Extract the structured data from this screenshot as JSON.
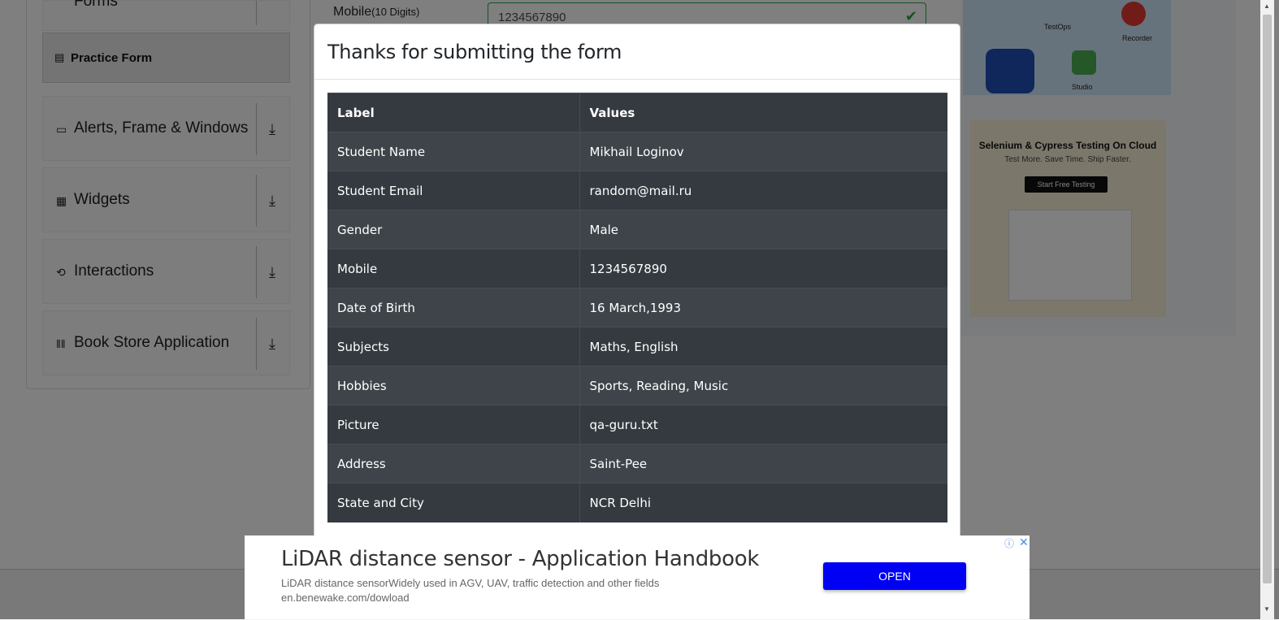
{
  "sidebar": {
    "forms_label": "Forms",
    "practice_form": "Practice Form",
    "groups": [
      {
        "label": "Alerts, Frame & Windows",
        "icon": "window-icon"
      },
      {
        "label": "Widgets",
        "icon": "widgets-icon"
      },
      {
        "label": "Interactions",
        "icon": "interactions-icon"
      },
      {
        "label": "Book Store Application",
        "icon": "books-icon"
      }
    ]
  },
  "form": {
    "mobile_label": "Mobile",
    "mobile_hint": "(10 Digits)",
    "mobile_value": "1234567890"
  },
  "right_ads": {
    "ad1": {
      "labels": [
        "TestOps",
        "Recorder",
        "Studio"
      ]
    },
    "ad2": {
      "title": "Selenium & Cypress Testing On Cloud",
      "subtitle": "Test More. Save Time. Ship Faster.",
      "button": "Start Free Testing"
    }
  },
  "modal": {
    "title": "Thanks for submitting the form",
    "columns": [
      "Label",
      "Values"
    ],
    "rows": [
      [
        "Student Name",
        "Mikhail Loginov"
      ],
      [
        "Student Email",
        "random@mail.ru"
      ],
      [
        "Gender",
        "Male"
      ],
      [
        "Mobile",
        "1234567890"
      ],
      [
        "Date of Birth",
        "16 March,1993"
      ],
      [
        "Subjects",
        "Maths, English"
      ],
      [
        "Hobbies",
        "Sports, Reading, Music"
      ],
      [
        "Picture",
        "qa-guru.txt"
      ],
      [
        "Address",
        "Saint-Pee"
      ],
      [
        "State and City",
        "NCR Delhi"
      ]
    ]
  },
  "bottom_ad": {
    "title": "LiDAR distance sensor - Application Handbook",
    "description": "LiDAR distance sensorWidely used in AGV, UAV, traffic detection and other fields",
    "url": "en.benewake.com/dowload",
    "button": "OPEN",
    "button_color": "#0000f5"
  }
}
